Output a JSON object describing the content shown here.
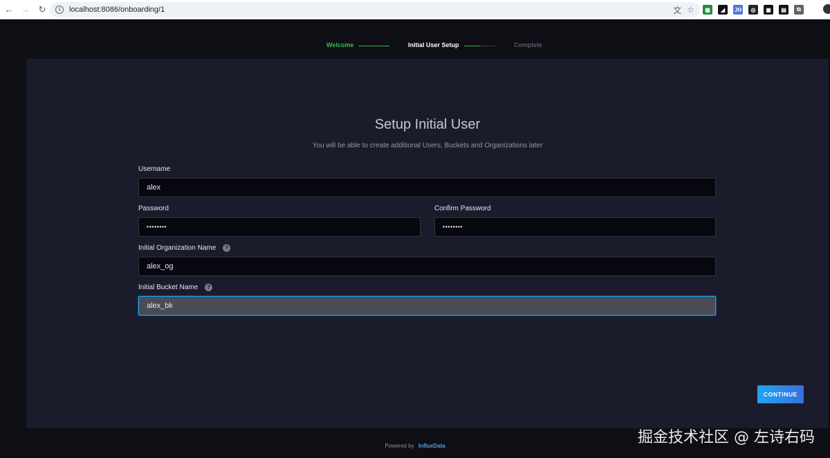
{
  "browser": {
    "url": "localhost:8086/onboarding/1",
    "back_icon": "←",
    "forward_icon": "→",
    "reload_icon": "↻",
    "info_icon": "i",
    "translate_icon": "文",
    "star_icon": "☆",
    "extensions": [
      {
        "name": "sheets-extension-icon",
        "color": "#1e8e3e",
        "glyph": "▦"
      },
      {
        "name": "notion-extension-icon",
        "color": "#111111",
        "glyph": "◢"
      },
      {
        "name": "jh-extension-icon",
        "color": "#4a78d8",
        "glyph": "JH"
      },
      {
        "name": "badge-extension-icon",
        "color": "#222222",
        "glyph": "◎"
      },
      {
        "name": "square-extension-icon",
        "color": "#111111",
        "glyph": "▣"
      },
      {
        "name": "box-extension-icon",
        "color": "#111111",
        "glyph": "▤"
      },
      {
        "name": "puzzle-extension-icon",
        "color": "#5f6368",
        "glyph": "⧉"
      }
    ]
  },
  "stepper": {
    "steps": [
      {
        "label": "Welcome",
        "state": "done",
        "color": "#34bb55"
      },
      {
        "label": "Initial User Setup",
        "state": "current",
        "color": "#ffffff"
      },
      {
        "label": "Complete",
        "state": "pending",
        "color": "#5a5c6b"
      }
    ]
  },
  "form": {
    "title": "Setup Initial User",
    "subtitle": "You will be able to create additional Users, Buckets and Organizations later",
    "username": {
      "label": "Username",
      "value": "alex"
    },
    "password": {
      "label": "Password",
      "value": "••••••••"
    },
    "confirm_password": {
      "label": "Confirm Password",
      "value": "••••••••"
    },
    "org": {
      "label": "Initial Organization Name",
      "value": "alex_og",
      "help_icon": "?"
    },
    "bucket": {
      "label": "Initial Bucket Name",
      "value": "alex_bk",
      "help_icon": "?"
    },
    "continue_label": "CONTINUE"
  },
  "footer": {
    "powered_by": "Powered by",
    "brand": "InfluxData"
  },
  "watermark": "掘金技术社区 @ 左诗右码"
}
